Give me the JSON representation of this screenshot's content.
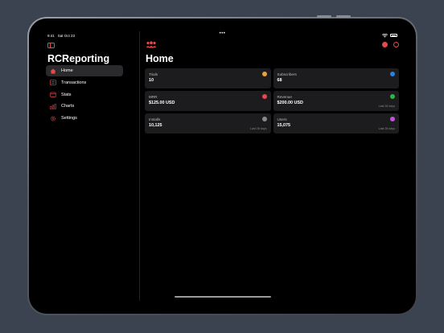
{
  "status_bar": {
    "time": "9:41",
    "date": "Sat Oct 23",
    "center_dots": "•••"
  },
  "sidebar": {
    "app_title": "RCReporting",
    "items": [
      {
        "label": "Home",
        "icon": "house-icon",
        "active": true
      },
      {
        "label": "Transactions",
        "icon": "list-icon",
        "active": false
      },
      {
        "label": "Stats",
        "icon": "calendar-icon",
        "active": false
      },
      {
        "label": "Charts",
        "icon": "bar-chart-icon",
        "active": false
      },
      {
        "label": "Settings",
        "icon": "gear-icon",
        "active": false
      }
    ]
  },
  "main": {
    "title": "Home",
    "header_icon": "people-icon",
    "top_right_icons": [
      "stop-icon",
      "refresh-icon"
    ]
  },
  "cards": [
    {
      "label": "Trials",
      "value": "10",
      "footer": "",
      "icon_color": "#e6a23c"
    },
    {
      "label": "Subscribers",
      "value": "68",
      "footer": "",
      "icon_color": "#2f7fe0"
    },
    {
      "label": "MRR",
      "value": "$125.00 USD",
      "footer": "",
      "icon_color": "#e5484d"
    },
    {
      "label": "Revenue",
      "value": "$200.00 USD",
      "footer": "Last 28 days",
      "icon_color": "#2fb344"
    },
    {
      "label": "Installs",
      "value": "10,125",
      "footer": "Last 28 days",
      "icon_color": "#8a8a8e"
    },
    {
      "label": "Users",
      "value": "15,075",
      "footer": "Last 28 days",
      "icon_color": "#c054d8"
    }
  ],
  "colors": {
    "accent": "#e5484d",
    "background": "#000000",
    "card": "#1c1c1e",
    "page": "#3b4250"
  }
}
